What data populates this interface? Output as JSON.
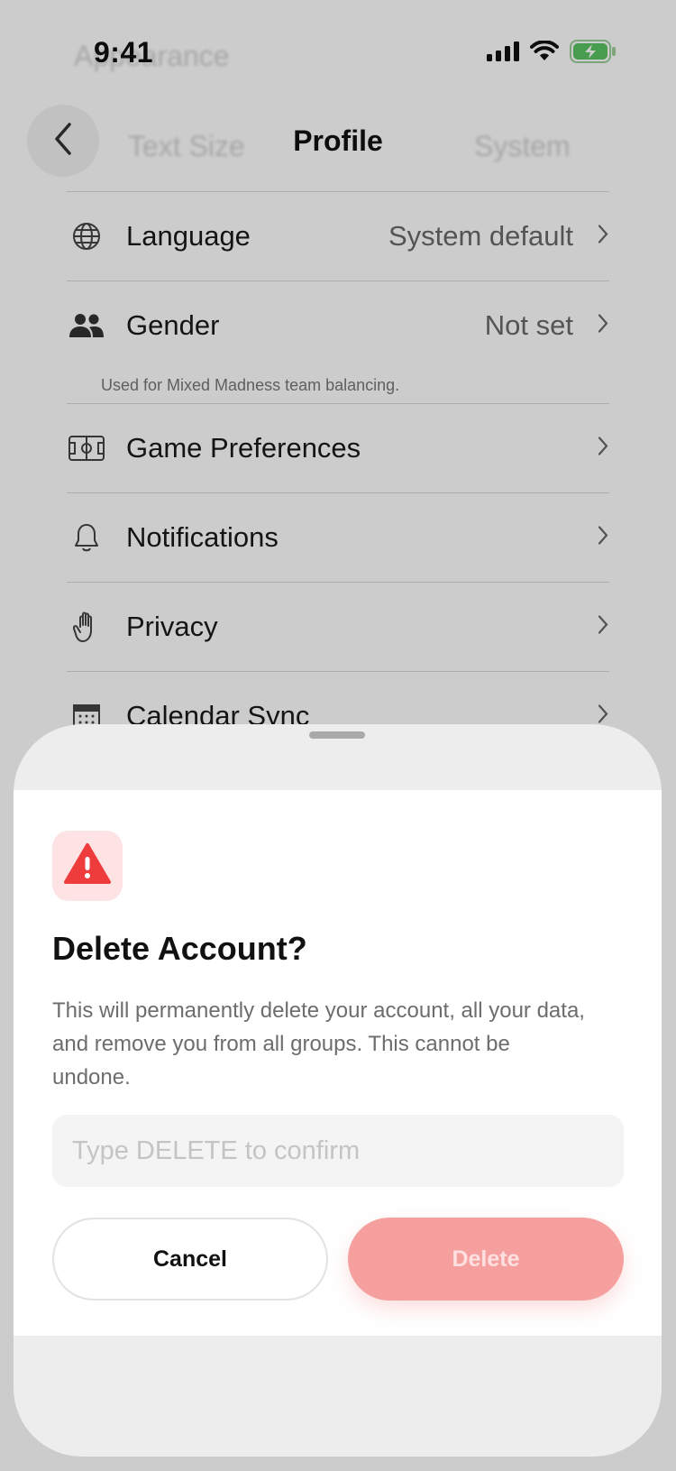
{
  "status_bar": {
    "time": "9:41"
  },
  "background_ghost": {
    "top_left": "Appearance",
    "text_size": "Text Size",
    "system": "System"
  },
  "header": {
    "title": "Profile"
  },
  "settings": {
    "language": {
      "label": "Language",
      "value": "System default"
    },
    "gender": {
      "label": "Gender",
      "value": "Not set",
      "hint": "Used for Mixed Madness team balancing."
    },
    "game_preferences": {
      "label": "Game Preferences"
    },
    "notifications": {
      "label": "Notifications"
    },
    "privacy": {
      "label": "Privacy"
    },
    "calendar_sync": {
      "label": "Calendar Sync"
    }
  },
  "dialog": {
    "title": "Delete Account?",
    "body": "This will permanently delete your account, all your data, and remove you from all groups. This cannot be undone.",
    "input_placeholder": "Type DELETE to confirm",
    "cancel_label": "Cancel",
    "delete_label": "Delete"
  },
  "colors": {
    "danger": "#ee3c3c",
    "danger_soft": "#f5a09f",
    "badge_bg": "#fde3e3"
  }
}
